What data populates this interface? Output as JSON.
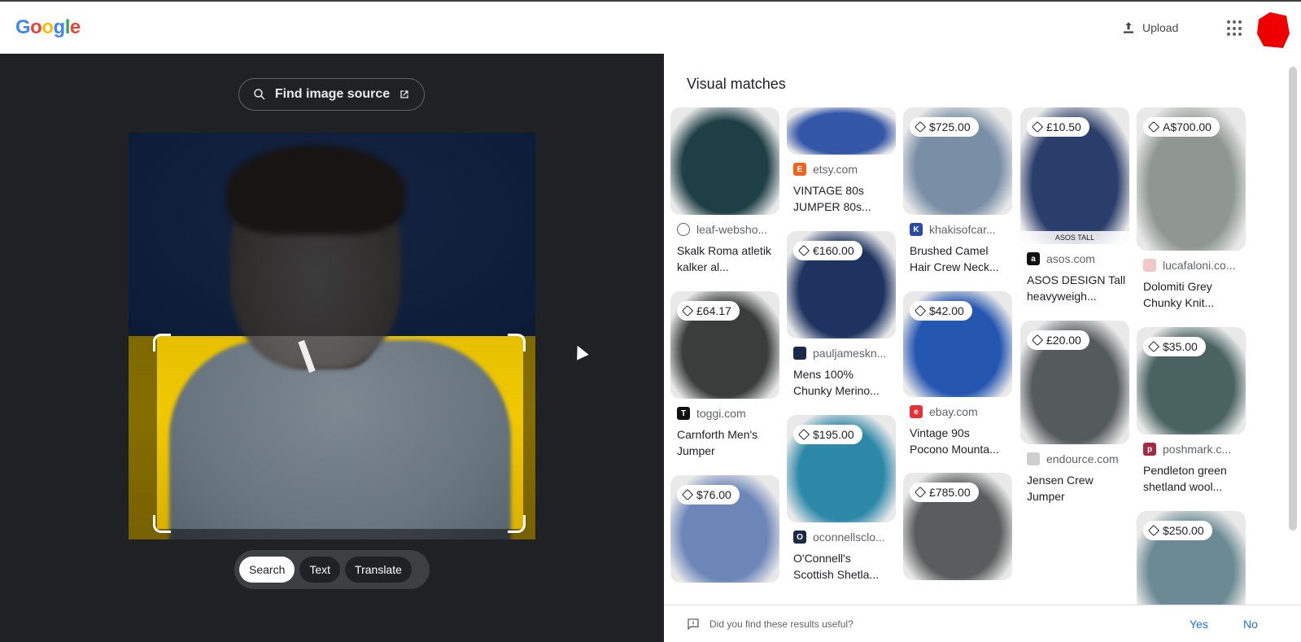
{
  "header": {
    "logo": "Google",
    "upload_label": "Upload"
  },
  "left": {
    "find_source_label": "Find image source",
    "modes": [
      "Search",
      "Text",
      "Translate"
    ],
    "active_mode": "Search"
  },
  "results": {
    "title": "Visual matches",
    "cards": [
      {
        "price": "",
        "source": "leaf-websho...",
        "title": "Skalk Roma atletik kalker al...",
        "thumb": "#1e3f45",
        "icon": "globe",
        "iconColor": "#5f6368"
      },
      {
        "price": "£64.17",
        "source": "toggi.com",
        "title": "Carnforth Men's Jumper",
        "thumb": "#3a3d3c",
        "icon": "T",
        "iconColor": "#111"
      },
      {
        "price": "$76.00",
        "source": "",
        "title": "",
        "thumb": "#6d86b8",
        "icon": "",
        "iconColor": ""
      },
      {
        "price": "",
        "source": "etsy.com",
        "title": "VINTAGE 80s JUMPER 80s...",
        "thumb": "#3456a6",
        "icon": "E",
        "iconColor": "#f1641e"
      },
      {
        "price": "€160.00",
        "source": "pauljameskn...",
        "title": "Mens 100% Chunky Merino...",
        "thumb": "#1e3360",
        "icon": "",
        "iconColor": "#1b2a49"
      },
      {
        "price": "$195.00",
        "source": "oconnellsclo...",
        "title": "O'Connell's Scottish Shetla...",
        "thumb": "#2d88a8",
        "icon": "O",
        "iconColor": "#1b2a49"
      },
      {
        "price": "$725.00",
        "source": "khakisofcar...",
        "title": "Brushed Camel Hair Crew Neck...",
        "thumb": "#7a8fa6",
        "icon": "K",
        "iconColor": "#2b4aa5"
      },
      {
        "price": "$42.00",
        "source": "ebay.com",
        "title": "Vintage 90s Pocono Mounta...",
        "thumb": "#2456b0",
        "icon": "e",
        "iconColor": "#e53238"
      },
      {
        "price": "£785.00",
        "source": "",
        "title": "",
        "thumb": "#5a5d5d",
        "icon": "",
        "iconColor": ""
      },
      {
        "price": "£10.50",
        "source": "asos.com",
        "title": "ASOS DESIGN Tall heavyweigh...",
        "thumb": "#2b3d6a",
        "icon": "a",
        "iconColor": "#111"
      },
      {
        "price": "£20.00",
        "source": "endource.com",
        "title": "Jensen Crew Jumper",
        "thumb": "#555a5c",
        "icon": "",
        "iconColor": "#cfcfcf"
      },
      {
        "price": "A$700.00",
        "source": "lucafaloni.co...",
        "title": "Dolomiti Grey Chunky Knit...",
        "thumb": "#8f9790",
        "icon": "",
        "iconColor": "#f4c7c7"
      },
      {
        "price": "$35.00",
        "source": "poshmark.c...",
        "title": "Pendleton green shetland wool...",
        "thumb": "#4a6361",
        "icon": "p",
        "iconColor": "#a32a43"
      },
      {
        "price": "$250.00",
        "source": "",
        "title": "",
        "thumb": "#6b8a93",
        "icon": "",
        "iconColor": ""
      }
    ],
    "feedback_question": "Did you find these results useful?",
    "yes_label": "Yes",
    "no_label": "No",
    "thumb_overlay_asos": "ASOS TALL"
  }
}
